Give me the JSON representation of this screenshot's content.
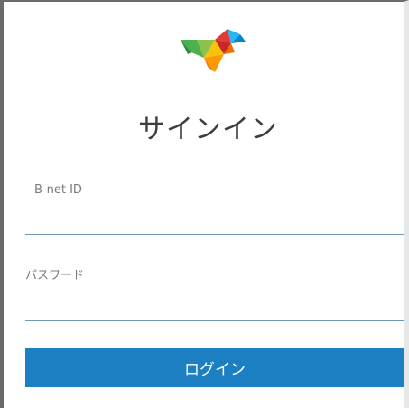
{
  "signin": {
    "title": "サインイン",
    "id_label": "B-net ID",
    "id_value": "",
    "password_label": "パスワード",
    "password_value": "",
    "login_label": "ログイン"
  },
  "brand": {
    "logo_icon": "colorful-bird-logo",
    "primary_button_color": "#1c7fc2",
    "input_underline_color": "#6f97b7"
  }
}
